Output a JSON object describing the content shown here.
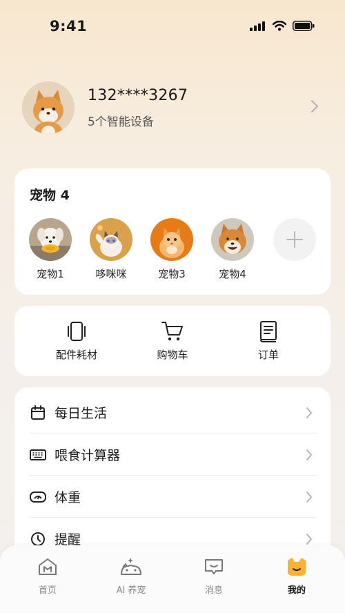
{
  "status_bar": {
    "time": "9:41"
  },
  "profile": {
    "phone": "132****3267",
    "devices": "5个智能设备"
  },
  "pets": {
    "title": "宠物 4",
    "items": [
      {
        "name": "宠物1"
      },
      {
        "name": "哆咪咪"
      },
      {
        "name": "宠物3"
      },
      {
        "name": "宠物4"
      }
    ]
  },
  "shortcuts": [
    {
      "label": "配件耗材",
      "icon": "phone-device-icon"
    },
    {
      "label": "购物车",
      "icon": "cart-icon"
    },
    {
      "label": "订单",
      "icon": "order-book-icon"
    }
  ],
  "menu": [
    {
      "label": "每日生活",
      "icon": "calendar-icon"
    },
    {
      "label": "喂食计算器",
      "icon": "keyboard-icon"
    },
    {
      "label": "体重",
      "icon": "scale-icon"
    },
    {
      "label": "提醒",
      "icon": "clock-icon"
    }
  ],
  "tabbar": [
    {
      "label": "首页",
      "icon": "home-icon"
    },
    {
      "label": "AI 养宠",
      "icon": "ai-pet-icon"
    },
    {
      "label": "消息",
      "icon": "message-icon"
    },
    {
      "label": "我的",
      "icon": "cat-face-icon",
      "active": true
    }
  ],
  "colors": {
    "accent": "#f5a623",
    "active_tab_icon": "#f9b233"
  }
}
